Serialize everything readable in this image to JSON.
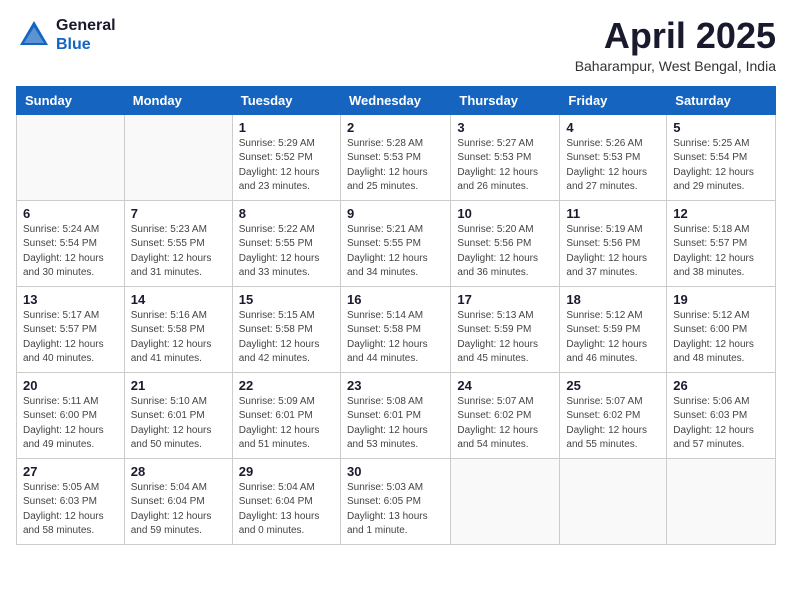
{
  "logo": {
    "general": "General",
    "blue": "Blue"
  },
  "title": {
    "month": "April 2025",
    "location": "Baharampur, West Bengal, India"
  },
  "headers": [
    "Sunday",
    "Monday",
    "Tuesday",
    "Wednesday",
    "Thursday",
    "Friday",
    "Saturday"
  ],
  "weeks": [
    [
      {
        "day": "",
        "info": ""
      },
      {
        "day": "",
        "info": ""
      },
      {
        "day": "1",
        "info": "Sunrise: 5:29 AM\nSunset: 5:52 PM\nDaylight: 12 hours\nand 23 minutes."
      },
      {
        "day": "2",
        "info": "Sunrise: 5:28 AM\nSunset: 5:53 PM\nDaylight: 12 hours\nand 25 minutes."
      },
      {
        "day": "3",
        "info": "Sunrise: 5:27 AM\nSunset: 5:53 PM\nDaylight: 12 hours\nand 26 minutes."
      },
      {
        "day": "4",
        "info": "Sunrise: 5:26 AM\nSunset: 5:53 PM\nDaylight: 12 hours\nand 27 minutes."
      },
      {
        "day": "5",
        "info": "Sunrise: 5:25 AM\nSunset: 5:54 PM\nDaylight: 12 hours\nand 29 minutes."
      }
    ],
    [
      {
        "day": "6",
        "info": "Sunrise: 5:24 AM\nSunset: 5:54 PM\nDaylight: 12 hours\nand 30 minutes."
      },
      {
        "day": "7",
        "info": "Sunrise: 5:23 AM\nSunset: 5:55 PM\nDaylight: 12 hours\nand 31 minutes."
      },
      {
        "day": "8",
        "info": "Sunrise: 5:22 AM\nSunset: 5:55 PM\nDaylight: 12 hours\nand 33 minutes."
      },
      {
        "day": "9",
        "info": "Sunrise: 5:21 AM\nSunset: 5:55 PM\nDaylight: 12 hours\nand 34 minutes."
      },
      {
        "day": "10",
        "info": "Sunrise: 5:20 AM\nSunset: 5:56 PM\nDaylight: 12 hours\nand 36 minutes."
      },
      {
        "day": "11",
        "info": "Sunrise: 5:19 AM\nSunset: 5:56 PM\nDaylight: 12 hours\nand 37 minutes."
      },
      {
        "day": "12",
        "info": "Sunrise: 5:18 AM\nSunset: 5:57 PM\nDaylight: 12 hours\nand 38 minutes."
      }
    ],
    [
      {
        "day": "13",
        "info": "Sunrise: 5:17 AM\nSunset: 5:57 PM\nDaylight: 12 hours\nand 40 minutes."
      },
      {
        "day": "14",
        "info": "Sunrise: 5:16 AM\nSunset: 5:58 PM\nDaylight: 12 hours\nand 41 minutes."
      },
      {
        "day": "15",
        "info": "Sunrise: 5:15 AM\nSunset: 5:58 PM\nDaylight: 12 hours\nand 42 minutes."
      },
      {
        "day": "16",
        "info": "Sunrise: 5:14 AM\nSunset: 5:58 PM\nDaylight: 12 hours\nand 44 minutes."
      },
      {
        "day": "17",
        "info": "Sunrise: 5:13 AM\nSunset: 5:59 PM\nDaylight: 12 hours\nand 45 minutes."
      },
      {
        "day": "18",
        "info": "Sunrise: 5:12 AM\nSunset: 5:59 PM\nDaylight: 12 hours\nand 46 minutes."
      },
      {
        "day": "19",
        "info": "Sunrise: 5:12 AM\nSunset: 6:00 PM\nDaylight: 12 hours\nand 48 minutes."
      }
    ],
    [
      {
        "day": "20",
        "info": "Sunrise: 5:11 AM\nSunset: 6:00 PM\nDaylight: 12 hours\nand 49 minutes."
      },
      {
        "day": "21",
        "info": "Sunrise: 5:10 AM\nSunset: 6:01 PM\nDaylight: 12 hours\nand 50 minutes."
      },
      {
        "day": "22",
        "info": "Sunrise: 5:09 AM\nSunset: 6:01 PM\nDaylight: 12 hours\nand 51 minutes."
      },
      {
        "day": "23",
        "info": "Sunrise: 5:08 AM\nSunset: 6:01 PM\nDaylight: 12 hours\nand 53 minutes."
      },
      {
        "day": "24",
        "info": "Sunrise: 5:07 AM\nSunset: 6:02 PM\nDaylight: 12 hours\nand 54 minutes."
      },
      {
        "day": "25",
        "info": "Sunrise: 5:07 AM\nSunset: 6:02 PM\nDaylight: 12 hours\nand 55 minutes."
      },
      {
        "day": "26",
        "info": "Sunrise: 5:06 AM\nSunset: 6:03 PM\nDaylight: 12 hours\nand 57 minutes."
      }
    ],
    [
      {
        "day": "27",
        "info": "Sunrise: 5:05 AM\nSunset: 6:03 PM\nDaylight: 12 hours\nand 58 minutes."
      },
      {
        "day": "28",
        "info": "Sunrise: 5:04 AM\nSunset: 6:04 PM\nDaylight: 12 hours\nand 59 minutes."
      },
      {
        "day": "29",
        "info": "Sunrise: 5:04 AM\nSunset: 6:04 PM\nDaylight: 13 hours\nand 0 minutes."
      },
      {
        "day": "30",
        "info": "Sunrise: 5:03 AM\nSunset: 6:05 PM\nDaylight: 13 hours\nand 1 minute."
      },
      {
        "day": "",
        "info": ""
      },
      {
        "day": "",
        "info": ""
      },
      {
        "day": "",
        "info": ""
      }
    ]
  ]
}
